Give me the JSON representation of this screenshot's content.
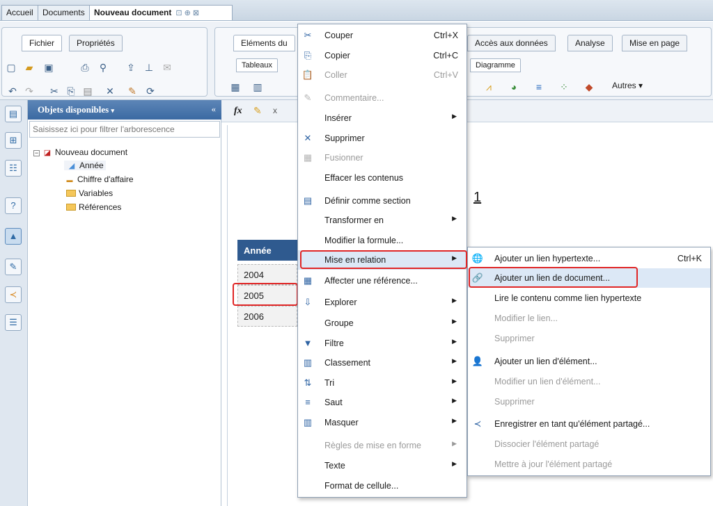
{
  "doc_tabs": {
    "home": "Accueil",
    "documents": "Documents",
    "current": "Nouveau document",
    "current_controls": "⊡ ⊕ ⊠"
  },
  "ribbon": {
    "left_tabs": [
      "Fichier",
      "Propriétés"
    ],
    "right_tabs": [
      "Eléments du",
      "Accès aux données",
      "Analyse",
      "Mise en page"
    ],
    "subtabs": [
      "Tableaux",
      "Diagramme"
    ],
    "others_label": "Autres"
  },
  "objects_panel": {
    "title": "Objets disponibles",
    "filter_placeholder": "Saisissez ici pour filtrer l'arborescence",
    "tree": {
      "root": "Nouveau document",
      "items": [
        "Année",
        "Chiffre d'affaire",
        "Variables",
        "Références"
      ]
    }
  },
  "formula_bar": {
    "fx": "fx",
    "x": "x"
  },
  "report": {
    "title_fragment": "1",
    "table_header": "Année",
    "rows": [
      "2004",
      "2005",
      "2006"
    ]
  },
  "context_menu": [
    {
      "icon": "✂",
      "label": "Couper",
      "shortcut": "Ctrl+X",
      "disabled": false
    },
    {
      "icon": "⎘",
      "label": "Copier",
      "shortcut": "Ctrl+C",
      "disabled": false
    },
    {
      "icon": "📋",
      "label": "Coller",
      "shortcut": "Ctrl+V",
      "disabled": true
    },
    {
      "icon": "✎",
      "label": "Commentaire...",
      "shortcut": "",
      "disabled": true
    },
    {
      "icon": "",
      "label": "Insérer",
      "shortcut": "",
      "disabled": false,
      "submenu": true
    },
    {
      "icon": "✕",
      "label": "Supprimer",
      "shortcut": "",
      "disabled": false
    },
    {
      "icon": "▦",
      "label": "Fusionner",
      "shortcut": "",
      "disabled": true
    },
    {
      "icon": "",
      "label": "Effacer les contenus",
      "shortcut": "",
      "disabled": false
    },
    {
      "icon": "▤",
      "label": "Définir comme section",
      "shortcut": "",
      "disabled": false
    },
    {
      "icon": "",
      "label": "Transformer en",
      "shortcut": "",
      "disabled": false,
      "submenu": true
    },
    {
      "icon": "",
      "label": "Modifier la formule...",
      "shortcut": "",
      "disabled": false
    },
    {
      "icon": "",
      "label": "Mise en relation",
      "shortcut": "",
      "disabled": false,
      "submenu": true,
      "highlight": true
    },
    {
      "icon": "▦",
      "label": "Affecter une référence...",
      "shortcut": "",
      "disabled": false
    },
    {
      "icon": "⇩",
      "label": "Explorer",
      "shortcut": "",
      "disabled": false,
      "submenu": true
    },
    {
      "icon": "",
      "label": "Groupe",
      "shortcut": "",
      "disabled": false,
      "submenu": true
    },
    {
      "icon": "▼",
      "label": "Filtre",
      "shortcut": "",
      "disabled": false,
      "submenu": true
    },
    {
      "icon": "▥",
      "label": "Classement",
      "shortcut": "",
      "disabled": false,
      "submenu": true
    },
    {
      "icon": "⇅",
      "label": "Tri",
      "shortcut": "",
      "disabled": false,
      "submenu": true
    },
    {
      "icon": "≡",
      "label": "Saut",
      "shortcut": "",
      "disabled": false,
      "submenu": true
    },
    {
      "icon": "▥",
      "label": "Masquer",
      "shortcut": "",
      "disabled": false,
      "submenu": true
    },
    {
      "icon": "",
      "label": "Règles de mise en forme",
      "shortcut": "",
      "disabled": true,
      "submenu": true
    },
    {
      "icon": "",
      "label": "Texte",
      "shortcut": "",
      "disabled": false,
      "submenu": true
    },
    {
      "icon": "",
      "label": "Format de cellule...",
      "shortcut": "",
      "disabled": false
    }
  ],
  "submenu": [
    {
      "icon": "🌐",
      "label": "Ajouter un lien hypertexte...",
      "shortcut": "Ctrl+K",
      "disabled": false
    },
    {
      "icon": "🔗",
      "label": "Ajouter un lien de document...",
      "shortcut": "",
      "disabled": false,
      "highlight": true
    },
    {
      "icon": "",
      "label": "Lire le contenu comme lien hypertexte",
      "shortcut": "",
      "disabled": false
    },
    {
      "icon": "",
      "label": "Modifier le lien...",
      "shortcut": "",
      "disabled": true
    },
    {
      "icon": "",
      "label": "Supprimer",
      "shortcut": "",
      "disabled": true
    },
    {
      "icon": "👤",
      "label": "Ajouter un lien d'élément...",
      "shortcut": "",
      "disabled": false
    },
    {
      "icon": "",
      "label": "Modifier un lien d'élément...",
      "shortcut": "",
      "disabled": true
    },
    {
      "icon": "",
      "label": "Supprimer",
      "shortcut": "",
      "disabled": true
    },
    {
      "icon": "≺",
      "label": "Enregistrer en tant qu'élément partagé...",
      "shortcut": "",
      "disabled": false
    },
    {
      "icon": "",
      "label": "Dissocier l'élément partagé",
      "shortcut": "",
      "disabled": true
    },
    {
      "icon": "",
      "label": "Mettre à jour l'élément partagé",
      "shortcut": "",
      "disabled": true
    }
  ],
  "colors": {
    "highlight_box": "#e02525",
    "header_blue": "#2f5a8f",
    "panel_head": "#3b6aa2"
  }
}
